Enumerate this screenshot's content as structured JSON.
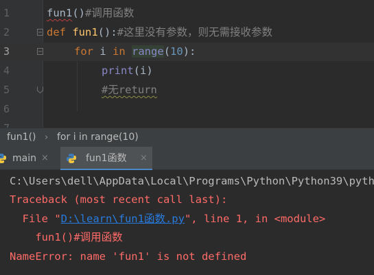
{
  "editor": {
    "lines": [
      {
        "num": "1",
        "t": {
          "call": "fun1",
          "paren": "()",
          "comment": "#调用函数"
        }
      },
      {
        "num": "2",
        "t": {
          "def": "def",
          "name": "fun1",
          "paren": "():",
          "comment": "#这里没有参数，则无需接收参数"
        }
      },
      {
        "num": "3",
        "t": {
          "for": "for",
          "var": " i ",
          "in": "in",
          "range": "range",
          "open": "(",
          "num": "10",
          "close": "):"
        }
      },
      {
        "num": "4",
        "t": {
          "print": "print",
          "args": "(i)"
        }
      },
      {
        "num": "5",
        "t": {
          "comment": "#无return"
        }
      },
      {
        "num": "6"
      },
      {
        "num": "7"
      }
    ]
  },
  "breadcrumb": {
    "items": [
      "fun1()",
      "for i in range(10)"
    ],
    "separator": "›"
  },
  "run_tabs": [
    {
      "label": "main",
      "close": "×"
    },
    {
      "label": "fun1函数",
      "close": "×"
    }
  ],
  "console": {
    "command": "C:\\Users\\dell\\AppData\\Local\\Programs\\Python\\Python39\\python.exe",
    "traceback": "Traceback (most recent call last):",
    "file_prefix": "  File \"",
    "file_link": "D:\\learn\\fun1函数.py",
    "file_suffix": "\", line 1, in <module>",
    "source_line": "    fun1()#调用函数",
    "error": "NameError: name 'fun1' is not defined"
  },
  "colors": {
    "keyword": "#cc7832",
    "function": "#ffc66d",
    "comment": "#808080",
    "number": "#6897bb",
    "error": "#ff6b68",
    "link": "#287bde"
  }
}
